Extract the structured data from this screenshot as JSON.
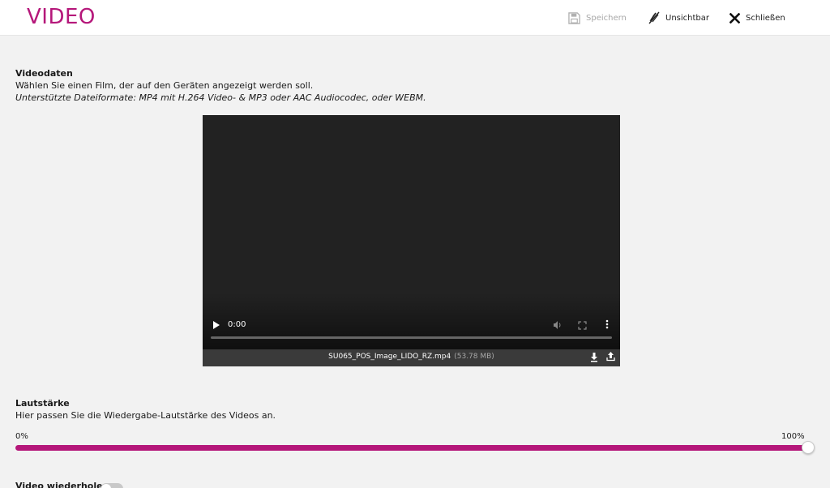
{
  "header": {
    "title": "VIDEO",
    "save_label": "Speichern",
    "invisible_label": "Unsichtbar",
    "close_label": "Schließen"
  },
  "video_section": {
    "title": "Videodaten",
    "description": "Wählen Sie einen Film, der auf den Geräten angezeigt werden soll.",
    "formats_note": "Unterstützte Dateiformate: MP4 mit H.264 Video- & MP3 oder AAC Audiocodec, oder WEBM."
  },
  "player": {
    "current_time": "0:00",
    "file_name": "SU065_POS_Image_LIDO_RZ.mp4",
    "file_size": "(53.78 MB)"
  },
  "volume_section": {
    "title": "Lautstärke",
    "description": "Hier passen Sie die Wiedergabe-Lautstärke des Videos an.",
    "min_label": "0%",
    "max_label": "100%",
    "value_fraction": 1.0
  },
  "repeat_section": {
    "label": "Video wiederholen",
    "enabled": false
  },
  "colors": {
    "accent": "#b5177a",
    "player_bg": "#222222",
    "file_bar_bg": "#3a3a3a"
  },
  "icons": {
    "save": "floppy-disk-icon",
    "invisible": "eye-slash-icon",
    "close": "close-icon",
    "play": "play-icon",
    "volume": "volume-icon",
    "fullscreen": "fullscreen-icon",
    "more": "more-vertical-icon",
    "download": "download-icon",
    "upload": "upload-icon"
  }
}
